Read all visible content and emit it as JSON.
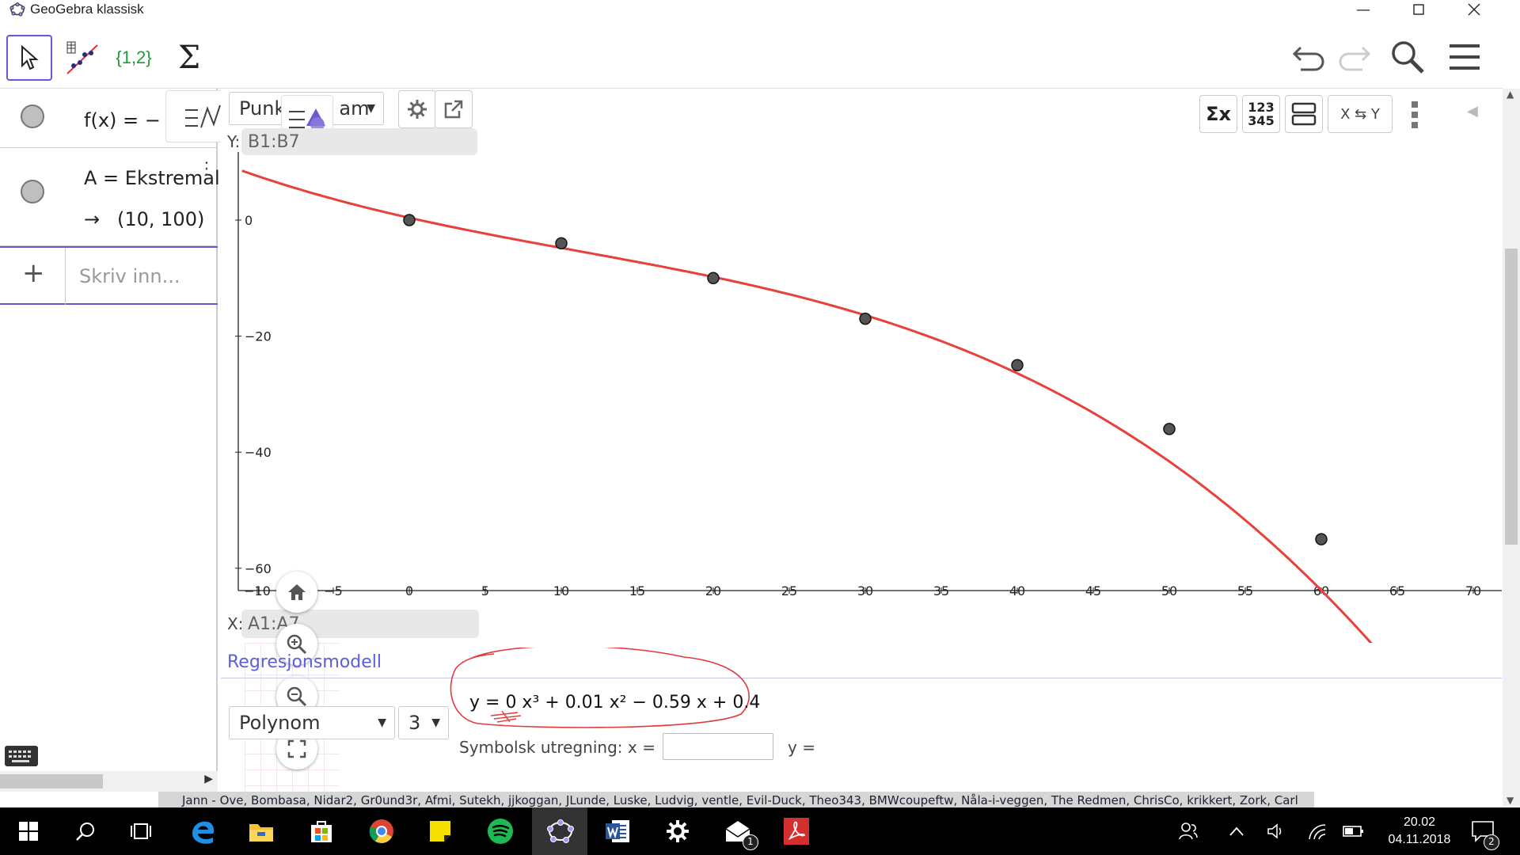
{
  "window": {
    "title": "GeoGebra klassisk"
  },
  "toolbar": {
    "list_tool_label": "{1,2}",
    "sum_tool_label": "Σ"
  },
  "algebra": {
    "rows": [
      {
        "expr": "f(x)  =  −"
      },
      {
        "expr": "A = Ekstremalp",
        "result": "(10, 100)"
      }
    ],
    "input_placeholder": "Skriv inn..."
  },
  "regression": {
    "plot_dropdown": "Punk",
    "plot_dropdown_tail": "am",
    "y_label": "Y:",
    "y_field": "B1:B7",
    "x_label": "X:",
    "x_field": "A1:A7",
    "model_link": "Regresjonsmodell",
    "model_select": "Polynom",
    "degree_select": "3",
    "equation": "y = 0 x³ + 0.01 x² − 0.59 x + 0.4",
    "symbolic_label": "Symbolsk utregning:",
    "x_eq": "x =",
    "y_eq": "y ="
  },
  "stats_toolbar": {
    "sum_x": "Σx",
    "num_123": "123",
    "num_345": "345",
    "swap": "X ⇆ Y"
  },
  "chart_data": {
    "type": "scatter",
    "x_ticks": [
      "−10",
      "−5",
      "0",
      "5",
      "10",
      "15",
      "20",
      "25",
      "30",
      "35",
      "40",
      "45",
      "50",
      "55",
      "60",
      "65",
      "70"
    ],
    "y_ticks": [
      "0",
      "−20",
      "−40",
      "−60"
    ],
    "points": [
      {
        "x": 0,
        "y": 0
      },
      {
        "x": 10,
        "y": -4
      },
      {
        "x": 20,
        "y": -10
      },
      {
        "x": 30,
        "y": -17
      },
      {
        "x": 40,
        "y": -25
      },
      {
        "x": 50,
        "y": -36
      },
      {
        "x": 60,
        "y": -55
      }
    ],
    "xlim": [
      -11,
      70
    ],
    "ylim": [
      -63,
      9
    ],
    "curve_color": "#e8413a",
    "point_color": "#555555"
  },
  "ticker": {
    "text": "Jann - Ove, Bombasa, Nidar2, Gr0und3r, Afmi, Sutekh, jjkoggan, JLunde, Luske, Ludvig, ventle, Evil-Duck, Theo343, BMWcoupeftw, Nåla-i-veggen, The Redmen, ChrisCo, krikkert, Zork, Carl"
  },
  "taskbar": {
    "time": "20.02",
    "date": "04.11.2018",
    "mail_badge": "1",
    "notif_badge": "2"
  }
}
